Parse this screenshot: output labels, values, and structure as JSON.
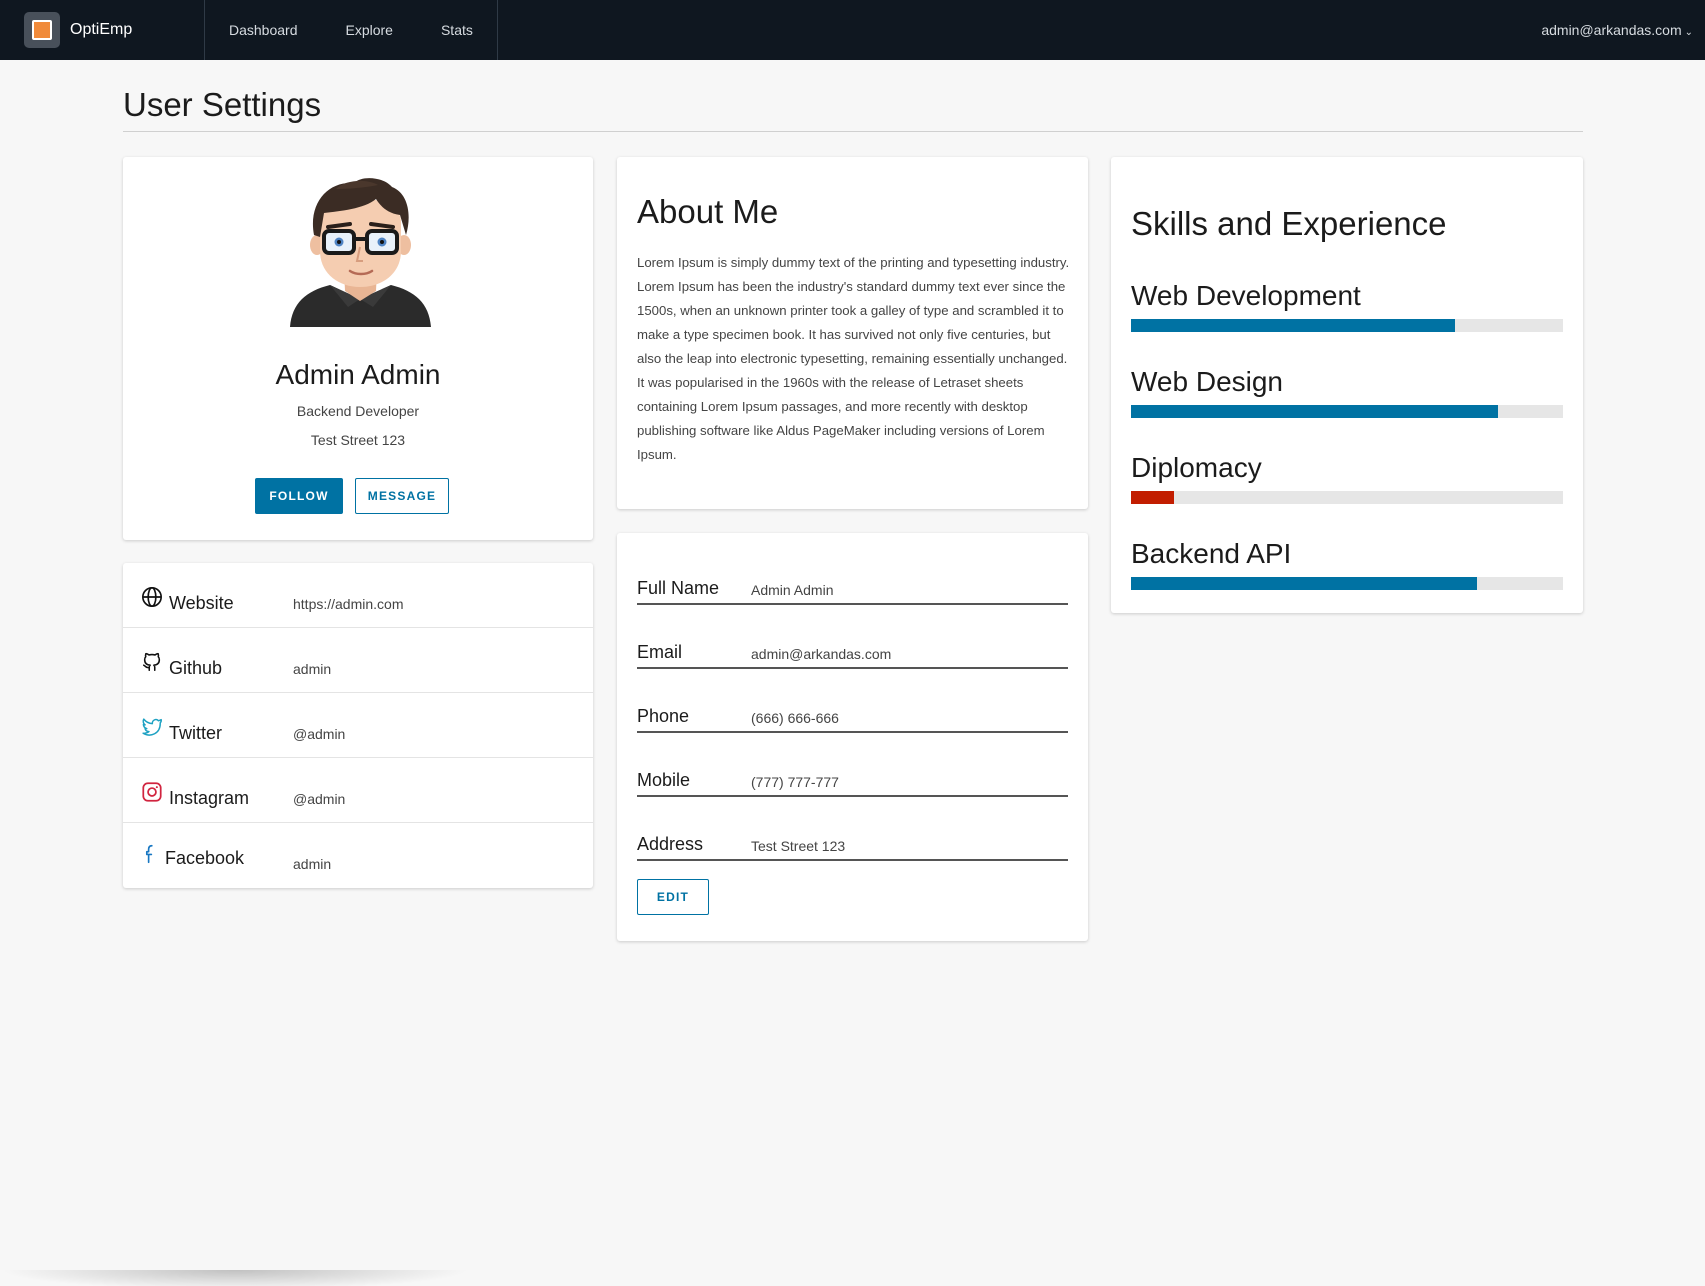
{
  "nav": {
    "brand": "OptiEmp",
    "links": [
      "Dashboard",
      "Explore",
      "Stats"
    ],
    "user": "admin@arkandas.com"
  },
  "page": {
    "title": "User Settings"
  },
  "profile": {
    "name": "Admin Admin",
    "role": "Backend Developer",
    "address": "Test Street 123",
    "follow_label": "FOLLOW",
    "message_label": "MESSAGE"
  },
  "social": [
    {
      "label": "Website",
      "value": "https://admin.com",
      "icon": "globe-icon"
    },
    {
      "label": "Github",
      "value": "admin",
      "icon": "github-icon"
    },
    {
      "label": "Twitter",
      "value": "@admin",
      "icon": "twitter-icon"
    },
    {
      "label": "Instagram",
      "value": "@admin",
      "icon": "instagram-icon"
    },
    {
      "label": "Facebook",
      "value": "admin",
      "icon": "facebook-icon"
    }
  ],
  "about": {
    "title": "About Me",
    "text": "Lorem Ipsum is simply dummy text of the printing and typesetting industry. Lorem Ipsum has been the industry's standard dummy text ever since the 1500s, when an unknown printer took a galley of type and scrambled it to make a type specimen book. It has survived not only five centuries, but also the leap into electronic typesetting, remaining essentially unchanged. It was popularised in the 1960s with the release of Letraset sheets containing Lorem Ipsum passages, and more recently with desktop publishing software like Aldus PageMaker including versions of Lorem Ipsum."
  },
  "info": {
    "fields": [
      {
        "label": "Full Name",
        "value": "Admin Admin"
      },
      {
        "label": "Email",
        "value": "admin@arkandas.com"
      },
      {
        "label": "Phone",
        "value": "(666) 666-666"
      },
      {
        "label": "Mobile",
        "value": "(777) 777-777"
      },
      {
        "label": "Address",
        "value": "Test Street 123"
      }
    ],
    "edit_label": "EDIT"
  },
  "skills": {
    "title": "Skills and Experience",
    "items": [
      {
        "name": "Web Development",
        "percent": 75,
        "status": "normal"
      },
      {
        "name": "Web Design",
        "percent": 85,
        "status": "normal"
      },
      {
        "name": "Diplomacy",
        "percent": 10,
        "status": "danger"
      },
      {
        "name": "Backend API",
        "percent": 80,
        "status": "normal"
      }
    ]
  },
  "colors": {
    "nav_bg": "#0f1720",
    "primary": "#0072a3",
    "danger": "#c21d00",
    "brand_orange": "#f08a3a"
  }
}
